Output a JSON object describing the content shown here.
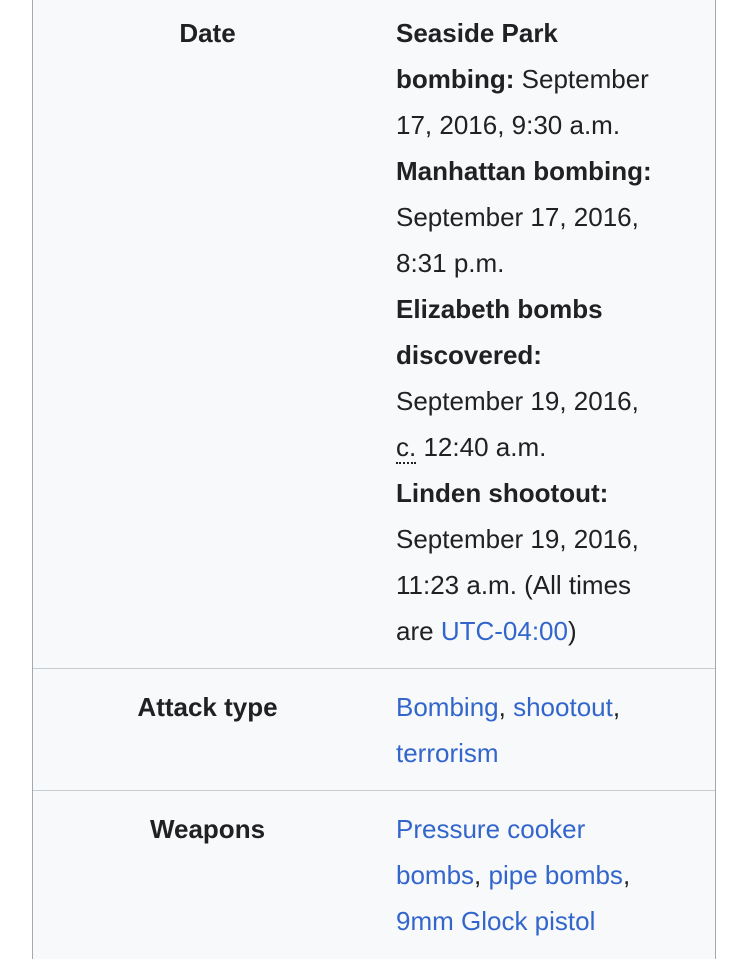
{
  "rows": {
    "date": {
      "label": "Date",
      "seaside_heading": "Seaside Park bombing:",
      "seaside_heading_l1": "Seaside Park",
      "seaside_heading_l2": "bombing:",
      "seaside_time_l1": "September",
      "seaside_time_l2": "17, 2016, 9:30 a.m.",
      "manhattan_heading": "Manhattan bombing:",
      "manhattan_time_l1": "September 17, 2016,",
      "manhattan_time_l2": "8:31 p.m.",
      "elizabeth_heading_l1": "Elizabeth bombs",
      "elizabeth_heading_l2": "discovered:",
      "elizabeth_time_l1": "September 19, 2016,",
      "elizabeth_circa": "c.",
      "elizabeth_time_l2": "12:40 a.m.",
      "linden_heading": "Linden shootout:",
      "linden_time_l1": "September 19, 2016,",
      "linden_time_l2": "11:23 a.m. (All times",
      "linden_are": "are",
      "utc_link": "UTC-04:00",
      "linden_close": ")"
    },
    "attack_type": {
      "label": "Attack type",
      "link_bombing": "Bombing",
      "sep1": ",",
      "link_shootout": "shootout",
      "sep2": ",",
      "link_terrorism": "terrorism"
    },
    "weapons": {
      "label": "Weapons",
      "link_pressure_l1": "Pressure cooker",
      "link_pressure_l2": "bombs",
      "sep1": ",",
      "link_pipe": "pipe bombs",
      "sep2": ",",
      "link_glock": "9mm Glock pistol"
    }
  }
}
